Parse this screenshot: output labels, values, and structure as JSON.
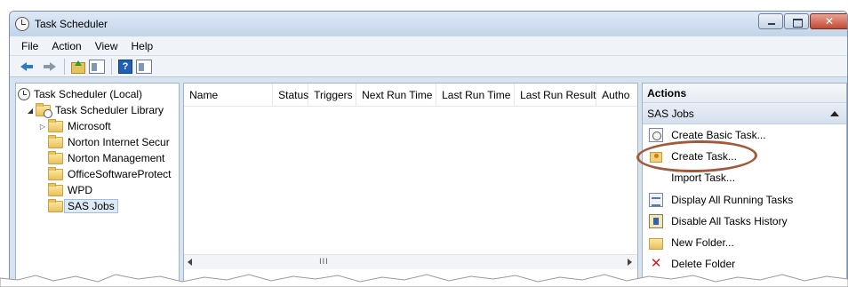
{
  "window": {
    "title": "Task Scheduler"
  },
  "menu": [
    "File",
    "Action",
    "View",
    "Help"
  ],
  "tree": {
    "root": "Task Scheduler (Local)",
    "library": "Task Scheduler Library",
    "folders": [
      "Microsoft",
      "Norton Internet Secur",
      "Norton Management",
      "OfficeSoftwareProtect",
      "WPD",
      "SAS Jobs"
    ],
    "selected": "SAS Jobs"
  },
  "list": {
    "columns": [
      "Name",
      "Status",
      "Triggers",
      "Next Run Time",
      "Last Run Time",
      "Last Run Result",
      "Autho"
    ],
    "scroll_grip": "III"
  },
  "actions": {
    "header": "Actions",
    "section": "SAS Jobs",
    "items": [
      "Create Basic Task...",
      "Create Task...",
      "Import Task...",
      "Display All Running Tasks",
      "Disable All Tasks History",
      "New Folder...",
      "Delete Folder"
    ],
    "highlighted": "Create Task..."
  },
  "colors": {
    "titlebar": "#c3d4e9",
    "highlight_ellipse": "#a35a3c",
    "selection": "#dfeaf7"
  }
}
